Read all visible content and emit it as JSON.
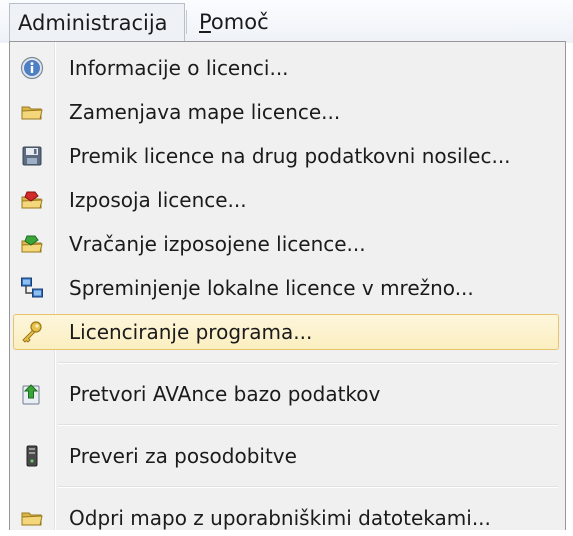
{
  "menubar": {
    "active_menu": "Administracija",
    "help_menu": "Pomoč",
    "help_menu_first": "P",
    "help_menu_rest": "omoč"
  },
  "dropdown": {
    "items": [
      {
        "label": "Informacije o licenci...",
        "icon": "info-icon"
      },
      {
        "label": "Zamenjava mape licence...",
        "icon": "folder-icon"
      },
      {
        "label": "Premik licence na drug podatkovni nosilec...",
        "icon": "floppy-disk-icon"
      },
      {
        "label": "Izposoja licence...",
        "icon": "folder-red-icon"
      },
      {
        "label": "Vračanje izposojene licence...",
        "icon": "folder-green-icon"
      },
      {
        "label": "Spreminjenje lokalne licence v mrežno...",
        "icon": "network-computers-icon"
      },
      {
        "label": "Licenciranje programa...",
        "icon": "key-icon",
        "highlighted": true
      },
      {
        "label": "Pretvori AVAnce bazo podatkov",
        "icon": "convert-database-icon"
      },
      {
        "label": "Preveri za posodobitve",
        "icon": "update-tower-icon"
      },
      {
        "label": "Odpri mapo z uporabniškimi datotekami...",
        "icon": "folder-icon"
      }
    ]
  },
  "colors": {
    "highlight_fill": "#fbeec0",
    "highlight_border": "#e6c46a",
    "menu_background": "#f0f0f0"
  }
}
